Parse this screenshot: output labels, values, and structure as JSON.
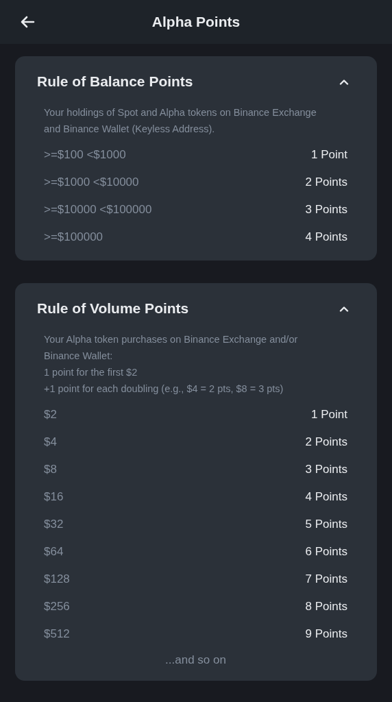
{
  "header": {
    "title": "Alpha Points"
  },
  "sections": [
    {
      "title": "Rule of Balance Points",
      "expanded": true,
      "description": "Your holdings of Spot and Alpha tokens on Binance Exchange\nand Binance Wallet (Keyless Address).",
      "rows": [
        {
          "condition": ">=$100 <$1000",
          "points": "1 Point"
        },
        {
          "condition": ">=$1000 <$10000",
          "points": "2 Points"
        },
        {
          "condition": ">=$10000 <$100000",
          "points": "3 Points"
        },
        {
          "condition": ">=$100000",
          "points": "4 Points"
        }
      ]
    },
    {
      "title": "Rule of Volume Points",
      "expanded": true,
      "description": "Your Alpha token purchases on Binance Exchange and/or\nBinance Wallet:\n1 point for the first $2\n+1 point for each doubling (e.g., $4 = 2 pts, $8 = 3 pts)",
      "rows": [
        {
          "condition": "$2",
          "points": "1 Point"
        },
        {
          "condition": "$4",
          "points": "2 Points"
        },
        {
          "condition": "$8",
          "points": "3 Points"
        },
        {
          "condition": "$16",
          "points": "4 Points"
        },
        {
          "condition": "$32",
          "points": "5 Points"
        },
        {
          "condition": "$64",
          "points": "6 Points"
        },
        {
          "condition": "$128",
          "points": "7 Points"
        },
        {
          "condition": "$256",
          "points": "8 Points"
        },
        {
          "condition": "$512",
          "points": "9 Points"
        }
      ],
      "footer": "...and so on"
    }
  ]
}
